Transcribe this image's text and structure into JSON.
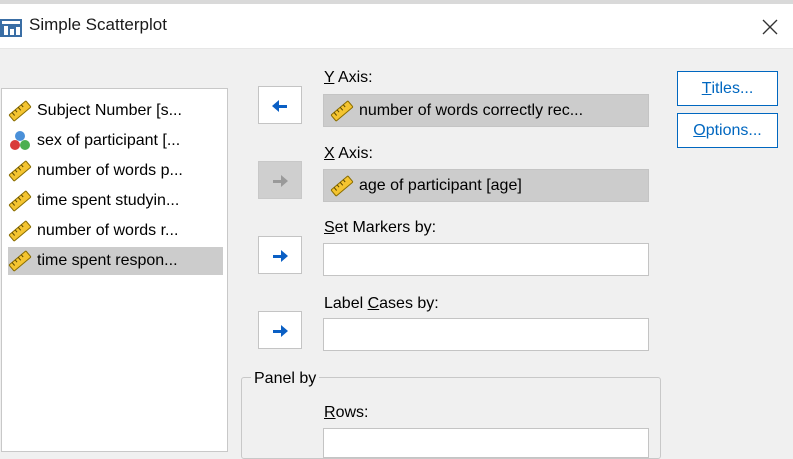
{
  "window": {
    "title": "Simple Scatterplot"
  },
  "variables": [
    {
      "label": "Subject Number [s...",
      "icon": "ruler-scale-icon"
    },
    {
      "label": "sex of participant [...",
      "icon": "nominal-icon"
    },
    {
      "label": "number of words p...",
      "icon": "ruler-scale-icon"
    },
    {
      "label": "time spent studyin...",
      "icon": "ruler-scale-icon"
    },
    {
      "label": "number of words r...",
      "icon": "ruler-scale-icon"
    },
    {
      "label": "time spent respon...",
      "icon": "ruler-scale-icon",
      "selected": true
    }
  ],
  "y_axis": {
    "label_key": "Y",
    "label_rest": " Axis:",
    "value": "number of words correctly rec..."
  },
  "x_axis": {
    "label_key": "X",
    "label_rest": " Axis:",
    "value": "age of participant [age]"
  },
  "set_markers": {
    "label_key": "S",
    "label_rest": "et Markers by:",
    "value": ""
  },
  "label_cases": {
    "label_pre": "Label ",
    "label_key": "C",
    "label_rest": "ases by:",
    "value": ""
  },
  "panel_by": {
    "legend": "Panel by",
    "rows_key": "R",
    "rows_rest": "ows:"
  },
  "buttons": {
    "titles_key": "T",
    "titles_rest": "itles...",
    "options_key": "O",
    "options_rest": "ptions..."
  },
  "colors": {
    "accent": "#0067c0",
    "selected": "#cccccc",
    "dialog_bg": "#f0f0f0"
  }
}
